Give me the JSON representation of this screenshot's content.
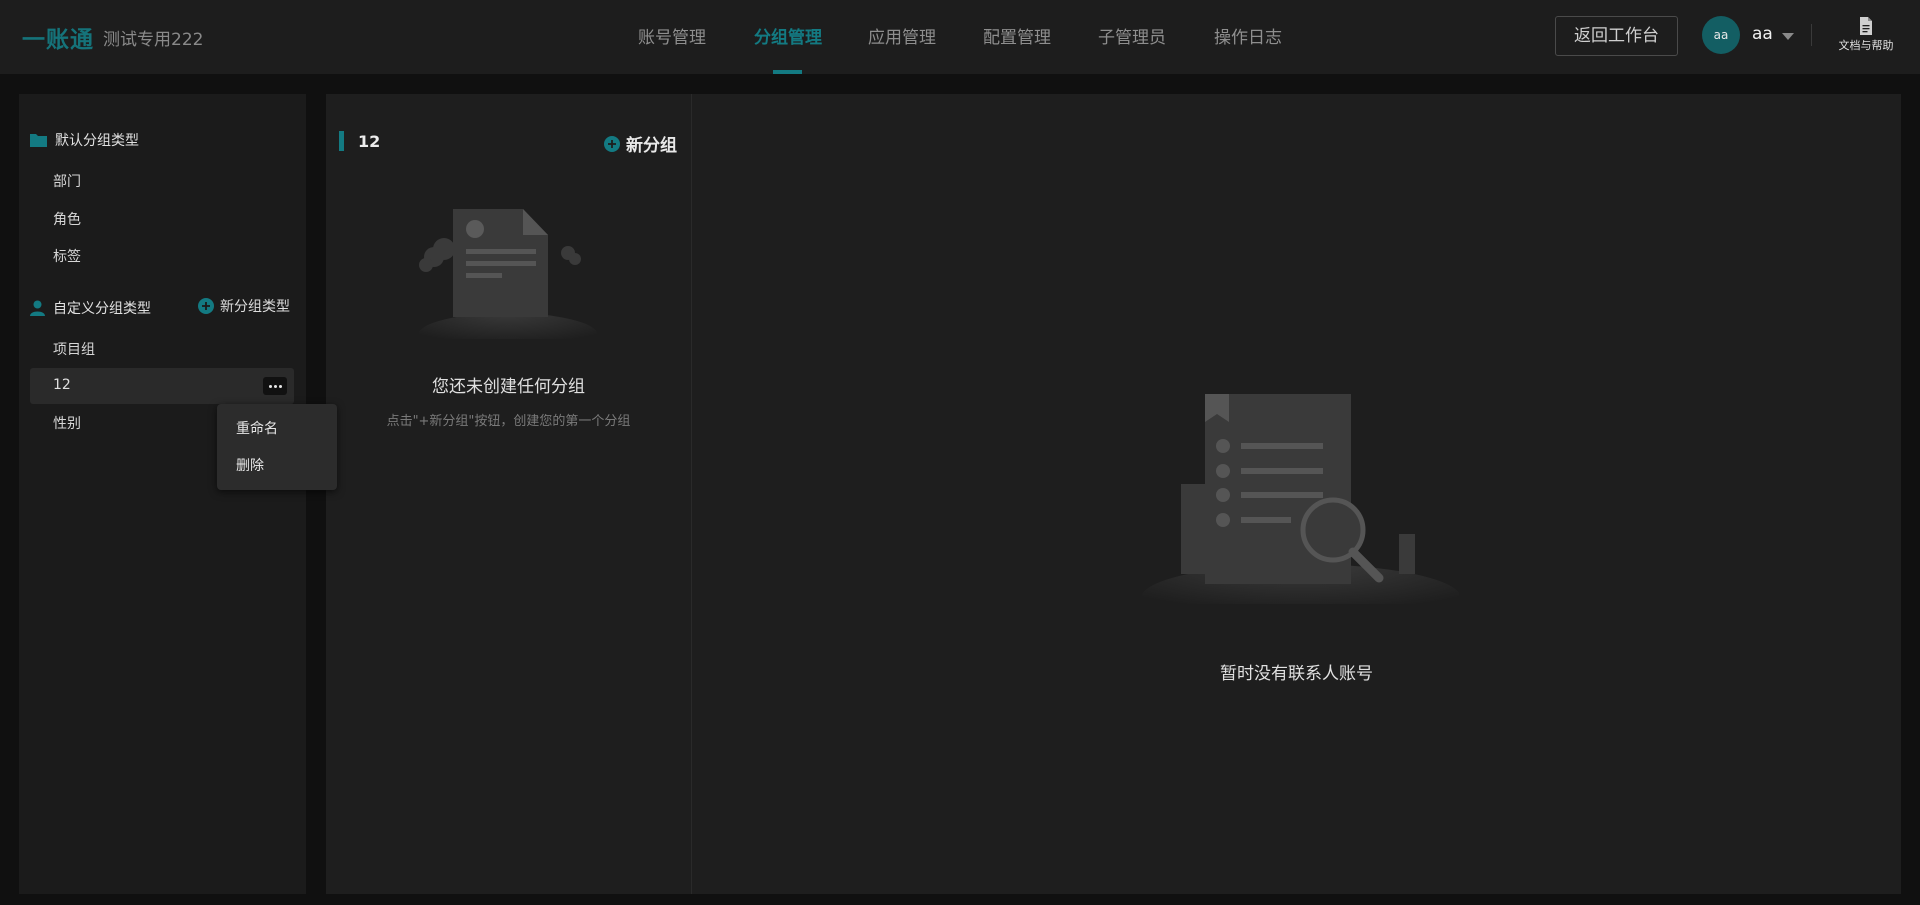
{
  "header": {
    "logo": "一账通",
    "tenant": "测试专用222",
    "nav": [
      {
        "label": "账号管理",
        "active": false
      },
      {
        "label": "分组管理",
        "active": true
      },
      {
        "label": "应用管理",
        "active": false
      },
      {
        "label": "配置管理",
        "active": false
      },
      {
        "label": "子管理员",
        "active": false
      },
      {
        "label": "操作日志",
        "active": false
      }
    ],
    "return_button": "返回工作台",
    "avatar_text": "aa",
    "username": "aa",
    "help_label": "文档与帮助"
  },
  "sidebar": {
    "default_section": {
      "title": "默认分组类型",
      "items": [
        "部门",
        "角色",
        "标签"
      ]
    },
    "custom_section": {
      "title": "自定义分组类型",
      "add_label": "新分组类型",
      "items": [
        "项目组",
        "12",
        "性别"
      ],
      "selected_index": 1
    },
    "context_menu": [
      "重命名",
      "删除"
    ]
  },
  "middle": {
    "title": "12",
    "new_group_label": "新分组",
    "empty_title": "您还未创建任何分组",
    "empty_hint": "点击\"+新分组\"按钮，创建您的第一个分组"
  },
  "right": {
    "empty_text": "暂时没有联系人账号"
  },
  "colors": {
    "accent": "#137a82",
    "background": "#101010",
    "panel": "#1e1e1e"
  }
}
